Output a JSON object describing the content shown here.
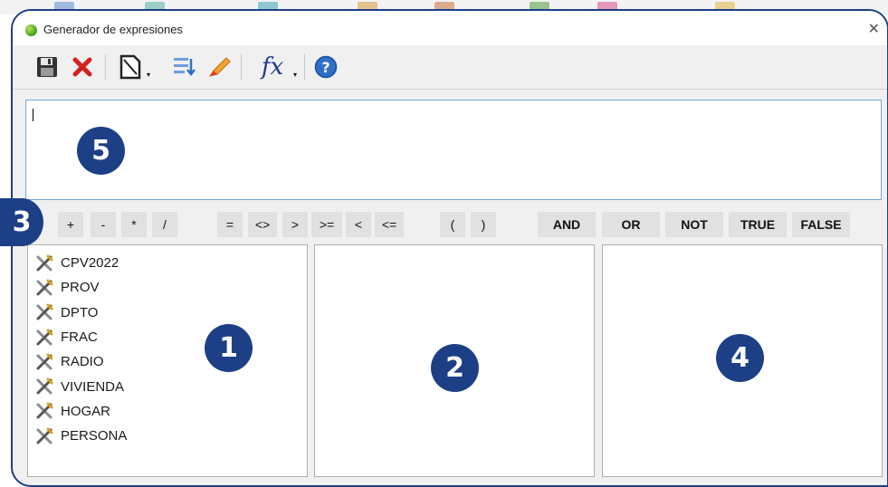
{
  "window": {
    "title": "Generador de expresiones"
  },
  "toolbar": {
    "icons": [
      "save-icon",
      "delete-icon",
      "new-document-icon",
      "insert-list-icon",
      "pencil-icon",
      "function-icon",
      "help-icon"
    ],
    "function_glyph": "fx"
  },
  "expression": {
    "value": ""
  },
  "operators": {
    "arithmetic": [
      "+",
      "-",
      "*",
      "/"
    ],
    "comparison": [
      "=",
      "<>",
      ">",
      ">=",
      "<",
      "<="
    ],
    "parentheses": [
      "(",
      ")"
    ],
    "logical": [
      "AND",
      "OR",
      "NOT",
      "TRUE",
      "FALSE"
    ]
  },
  "fields": [
    "CPV2022",
    "PROV",
    "DPTO",
    "FRAC",
    "RADIO",
    "VIVIENDA",
    "HOGAR",
    "PERSONA"
  ],
  "callouts": [
    "1",
    "2",
    "3",
    "4",
    "5"
  ],
  "colors": {
    "accent": "#1d3f86",
    "delete": "#d32020",
    "help": "#2f6fc6"
  }
}
